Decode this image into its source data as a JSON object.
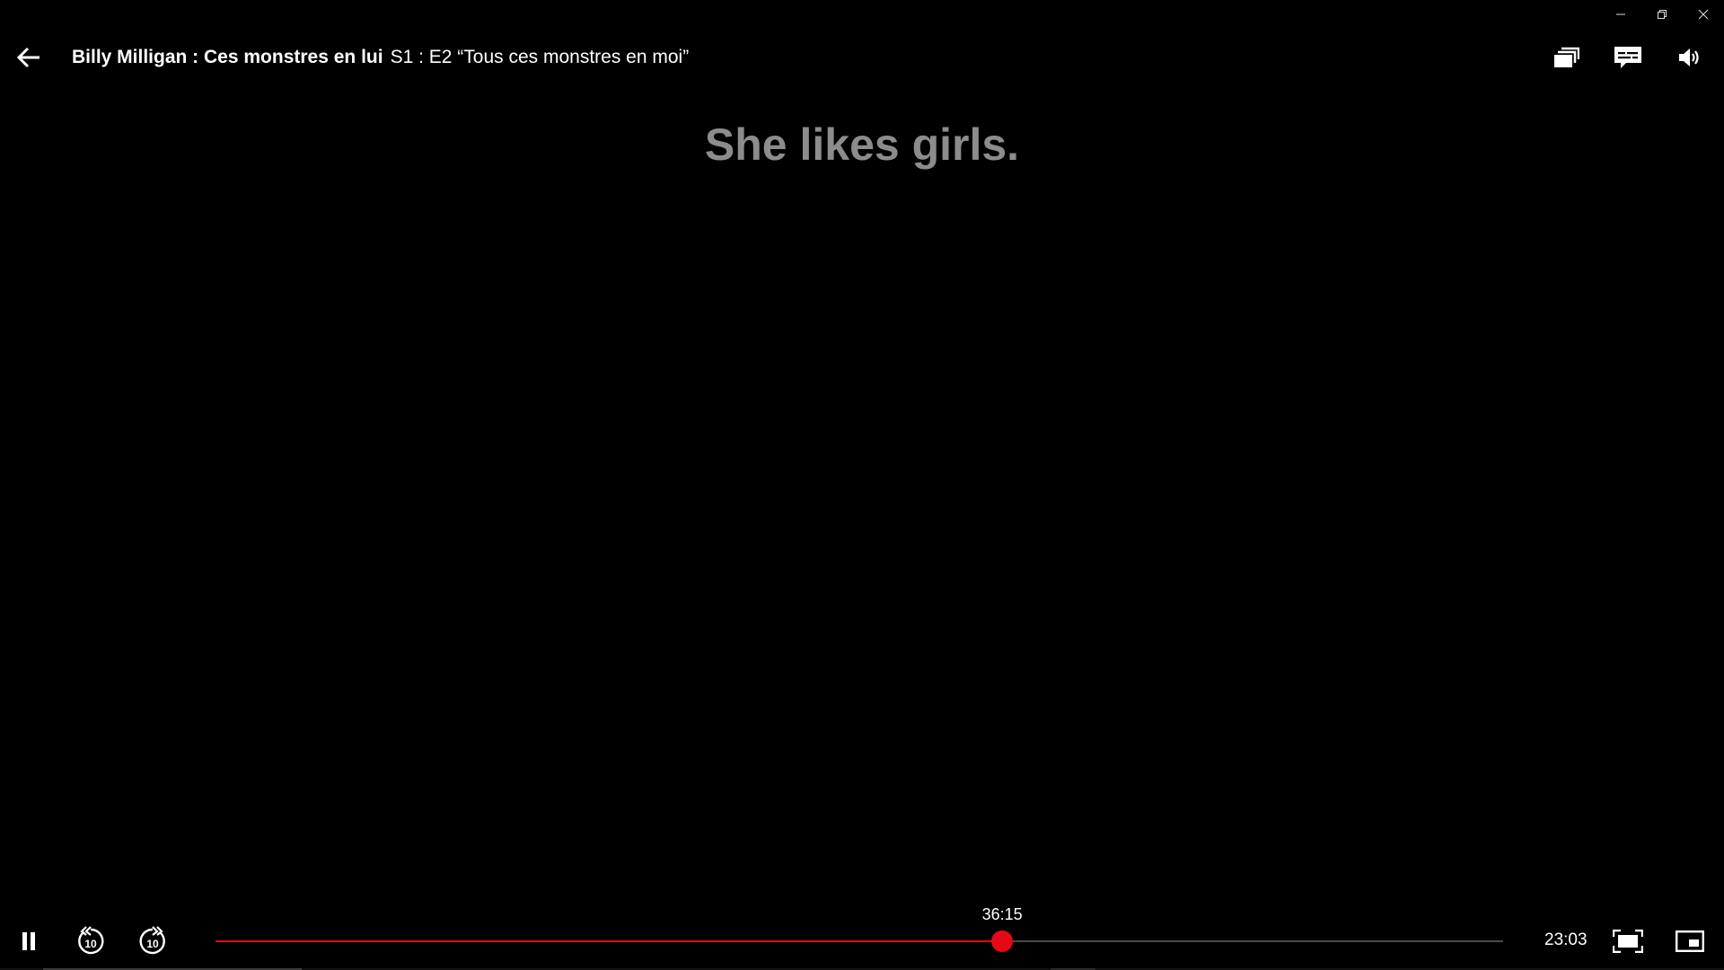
{
  "window": {
    "minimize_icon": "minimize-icon",
    "restore_icon": "restore-icon",
    "close_icon": "close-icon"
  },
  "header": {
    "show_title": "Billy Milligan : Ces monstres en lui",
    "episode_info": "S1 : E2 “Tous ces monstres en moi”",
    "back_icon": "arrow-left-icon",
    "icons": [
      "episodes-icon",
      "subtitles-icon",
      "volume-icon"
    ]
  },
  "subtitle": {
    "text": "She likes girls."
  },
  "controls": {
    "play_state_icon": "pause-icon",
    "rewind_label": "10",
    "forward_label": "10",
    "hover_time": "36:15",
    "remaining_time": "23:03",
    "progress": 0.611,
    "fullscreen_icon": "fullscreen-icon",
    "pip_icon": "picture-in-picture-icon"
  },
  "colors": {
    "accent": "#e50914",
    "subtitle": "#8c8c8c",
    "background": "#000000"
  }
}
